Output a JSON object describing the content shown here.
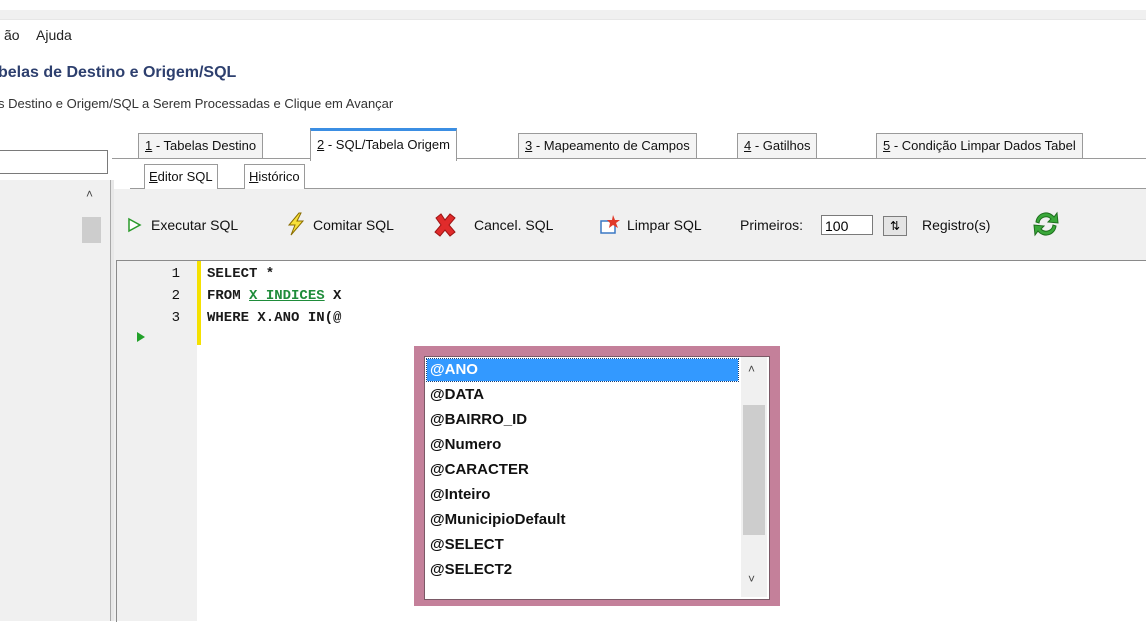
{
  "menu": {
    "items": [
      "ão",
      "Ajuda"
    ]
  },
  "wizard": {
    "title": "belas de Destino e Origem/SQL",
    "subtitle": "s Destino e Origem/SQL a Serem Processadas e Clique em Avançar"
  },
  "tabs": [
    {
      "key": "1",
      "label": " - Tabelas Destino"
    },
    {
      "key": "2",
      "label": " - SQL/Tabela Origem"
    },
    {
      "key": "3",
      "label": " - Mapeamento de Campos"
    },
    {
      "key": "4",
      "label": " - Gatilhos"
    },
    {
      "key": "5",
      "label": " - Condição Limpar Dados Tabel"
    }
  ],
  "subtabs": [
    {
      "key": "E",
      "label": "ditor SQL"
    },
    {
      "key": "H",
      "label": "istórico"
    }
  ],
  "toolbar": {
    "execute": "Executar SQL",
    "commit": "Comitar SQL",
    "cancel": "Cancel. SQL",
    "clear": "Limpar SQL",
    "first_label": "Primeiros:",
    "first_value": "100",
    "records": "Registro(s)"
  },
  "editor": {
    "lines": [
      {
        "num": "1",
        "pre": "SELECT *",
        "table": "",
        "post": ""
      },
      {
        "num": "2",
        "pre": "FROM ",
        "table": "X_INDICES",
        "post": " X"
      },
      {
        "num": "3",
        "pre": "WHERE X.ANO IN(@",
        "table": "",
        "post": ""
      }
    ]
  },
  "autocomplete": {
    "selected_index": 0,
    "items": [
      "@ANO",
      "@DATA",
      "@BAIRRO_ID",
      "@Numero",
      "@CARACTER",
      "@Inteiro",
      "@MunicipioDefault",
      "@SELECT",
      "@SELECT2"
    ]
  },
  "colors": {
    "accent": "#3399ff",
    "popup_border": "#c4809a",
    "table_name": "#1f8c3a",
    "tab_active_top": "#3b8ee3"
  },
  "icons": [
    "play-icon",
    "lightning-icon",
    "cancel-x-icon",
    "clear-icon",
    "spin-icon",
    "refresh-icon",
    "execution-arrow-icon"
  ]
}
